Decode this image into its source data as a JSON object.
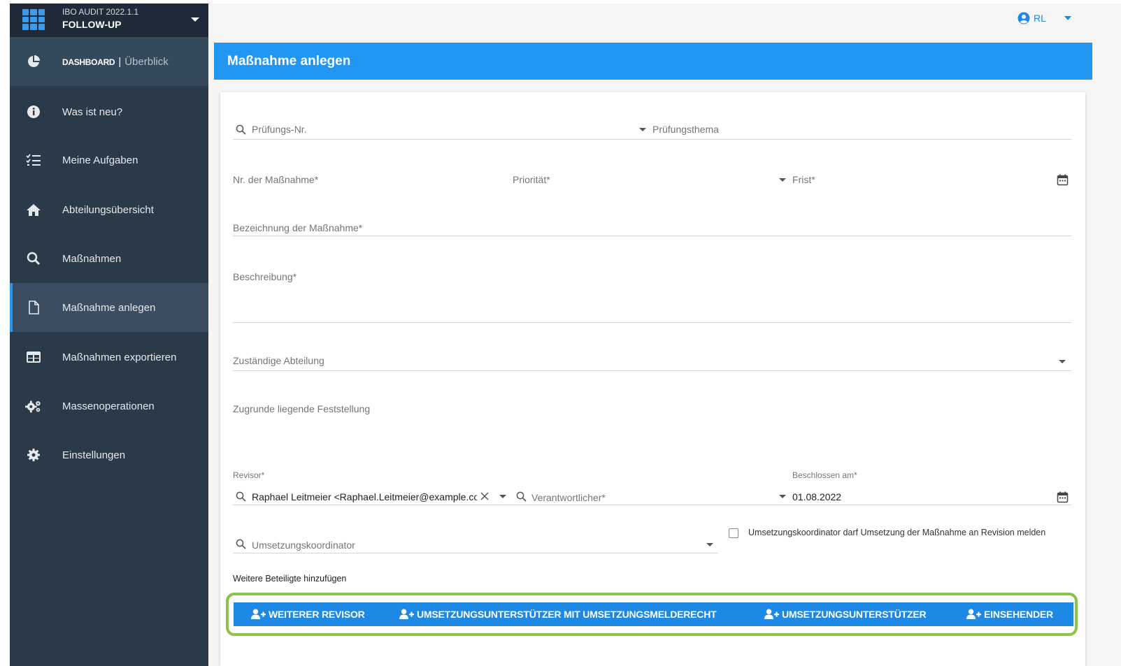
{
  "app": {
    "version": "IBO AUDIT 2022.1.1",
    "name": "FOLLOW-UP"
  },
  "sidebar": {
    "dashboard": {
      "strong": "DASHBOARD",
      "separator": "|",
      "sub": "Überblick",
      "icon": "pie-chart-icon"
    },
    "items": [
      {
        "label": "Was ist neu?",
        "icon": "info-icon"
      },
      {
        "label": "Meine Aufgaben",
        "icon": "checklist-icon"
      },
      {
        "label": "Abteilungsübersicht",
        "icon": "home-icon"
      },
      {
        "label": "Maßnahmen",
        "icon": "search-icon"
      },
      {
        "label": "Maßnahme anlegen",
        "icon": "document-icon",
        "active": true
      },
      {
        "label": "Maßnahmen exportieren",
        "icon": "table-icon"
      },
      {
        "label": "Massenoperationen",
        "icon": "gears-icon"
      },
      {
        "label": "Einstellungen",
        "icon": "gear-icon"
      }
    ]
  },
  "user": {
    "initials": "RL",
    "icon": "user-circle-icon"
  },
  "page": {
    "title": "Maßnahme anlegen"
  },
  "form": {
    "pruefungs_nr": {
      "placeholder": "Prüfungs-Nr."
    },
    "pruefungsthema": {
      "placeholder": "Prüfungsthema"
    },
    "nr_massnahme": {
      "placeholder": "Nr. der Maßnahme*"
    },
    "prioritaet": {
      "placeholder": "Priorität*"
    },
    "frist": {
      "placeholder": "Frist*"
    },
    "bezeichnung": {
      "placeholder": "Bezeichnung der Maßnahme*"
    },
    "beschreibung": {
      "placeholder": "Beschreibung*"
    },
    "abteilung": {
      "placeholder": "Zuständige Abteilung"
    },
    "feststellung": {
      "placeholder": "Zugrunde liegende Feststellung"
    },
    "revisor": {
      "label": "Revisor*",
      "value": "Raphael Leitmeier <Raphael.Leitmeier@example.com>"
    },
    "verantwortlicher": {
      "placeholder": "Verantwortlicher*"
    },
    "beschlossen": {
      "label": "Beschlossen am*",
      "value": "01.08.2022"
    },
    "koordinator": {
      "placeholder": "Umsetzungskoordinator"
    },
    "koordinator_checkbox": {
      "label": "Umsetzungskoordinator darf Umsetzung der Maßnahme an Revision melden",
      "checked": false
    },
    "weitere_label": "Weitere Beteiligte hinzufügen"
  },
  "buttons": [
    {
      "label": "WEITERER REVISOR"
    },
    {
      "label": "UMSETZUNGSUNTERSTÜTZER MIT UMSETZUNGSMELDERECHT"
    },
    {
      "label": "UMSETZUNGSUNTERSTÜTZER"
    },
    {
      "label": "EINSEHENDER"
    }
  ],
  "colors": {
    "primary": "#2196f3",
    "sidebar": "#2b3a49",
    "highlight": "#8bc34a"
  }
}
